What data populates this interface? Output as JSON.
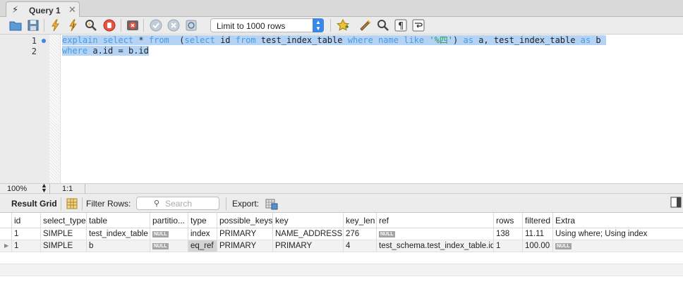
{
  "tab": {
    "title": "Query 1",
    "close": "✕"
  },
  "toolbar": {
    "limit_value": "Limit to 1000 rows",
    "icons": [
      "open-folder-icon",
      "save-icon",
      "execute-icon",
      "execute-current-icon",
      "explain-icon",
      "stop-icon",
      "toggle-error-icon",
      "commit-icon",
      "rollback-icon",
      "autocommit-icon",
      "bookmark-icon",
      "beautify-icon",
      "find-icon",
      "invisible-chars-icon",
      "wrap-icon"
    ]
  },
  "editor": {
    "line_numbers": [
      "1",
      "2"
    ]
  },
  "status": {
    "zoom": "100%",
    "position": "1:1"
  },
  "results": {
    "result_grid_label": "Result Grid",
    "filter_label": "Filter Rows:",
    "search_placeholder": "Search",
    "export_label": "Export:"
  },
  "grid": {
    "null_text": "NULL",
    "columns": [
      "id",
      "select_type",
      "table",
      "partitio...",
      "type",
      "possible_keys",
      "key",
      "key_len",
      "ref",
      "rows",
      "filtered",
      "Extra"
    ],
    "rows": [
      [
        "1",
        "SIMPLE",
        "test_index_table",
        null,
        "index",
        "PRIMARY",
        "NAME_ADDRESS",
        "276",
        null,
        "138",
        "11.11",
        "Using where; Using index"
      ],
      [
        "1",
        "SIMPLE",
        "b",
        null,
        "eq_ref",
        "PRIMARY",
        "PRIMARY",
        "4",
        "test_schema.test_index_table.id",
        "1",
        "100.00",
        null
      ]
    ]
  },
  "colors": {
    "accent": "#3b87e8",
    "keyword": "#4a9be0",
    "selection": "#b4d3f5"
  }
}
